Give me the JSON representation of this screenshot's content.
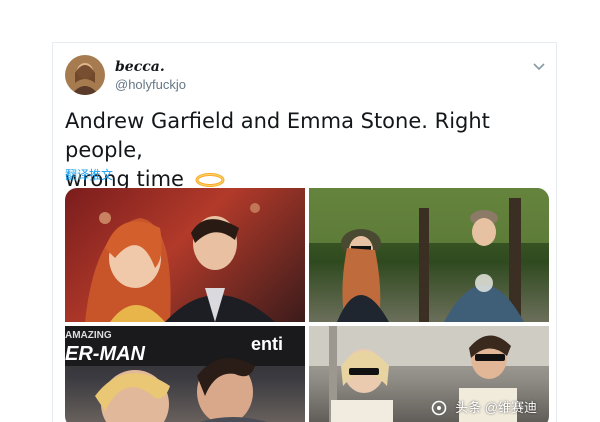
{
  "tweet": {
    "display_name": "becca.",
    "handle": "@holyfuckjo",
    "text_line1": "Andrew Garfield and Emma Stone. Right people,",
    "text_line2": "wrong time",
    "emoji": "halo-icon",
    "translate_label": "翻译推文"
  },
  "media": {
    "photo3_sign_text1": "AMAZING",
    "photo3_sign_text2": "ER-MAN",
    "photo3_sign_text3": "enti"
  },
  "watermark": {
    "text": "头条 @维赛迪"
  },
  "colors": {
    "link": "#1da1f2",
    "text": "#14171a",
    "muted": "#657786"
  }
}
